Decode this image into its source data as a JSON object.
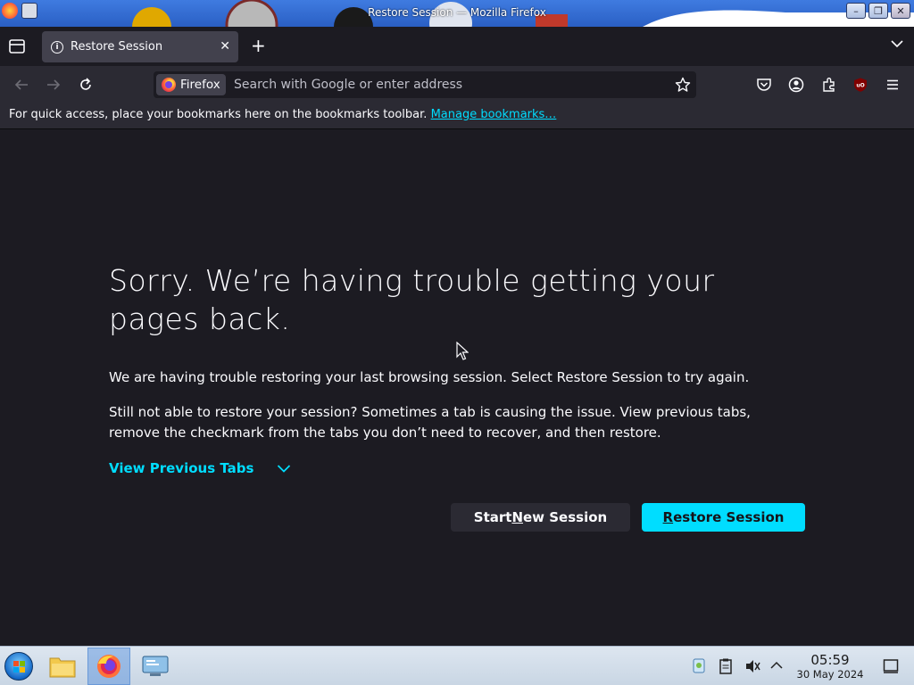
{
  "window": {
    "title": "Restore Session — Mozilla Firefox"
  },
  "tabs": [
    {
      "label": "Restore Session",
      "active": true,
      "icon": "info-icon"
    }
  ],
  "urlbar": {
    "identity_label": "Firefox",
    "placeholder": "Search with Google or enter address"
  },
  "bookmarks_bar": {
    "message": "For quick access, place your bookmarks here on the bookmarks toolbar.",
    "link": "Manage bookmarks…"
  },
  "page": {
    "heading": "Sorry. We’re having trouble getting your pages back.",
    "paragraph1": "We are having trouble restoring your last browsing session. Select Restore Session to try again.",
    "paragraph2": "Still not able to restore your session? Sometimes a tab is causing the issue. View previous tabs, remove the checkmark from the tabs you don’t need to recover, and then restore.",
    "view_previous_tabs": "View Previous Tabs",
    "start_new_session": {
      "before": "Start ",
      "accesskey": "N",
      "after": "ew Session"
    },
    "restore_session": {
      "before": "",
      "accesskey": "R",
      "after": "estore Session"
    }
  },
  "taskbar": {
    "time": "05:59",
    "date": "30 May 2024"
  },
  "colors": {
    "page_bg": "#1c1b22",
    "toolbar_bg": "#2b2a33",
    "accent": "#00ddff",
    "text": "#fbfbfe"
  }
}
